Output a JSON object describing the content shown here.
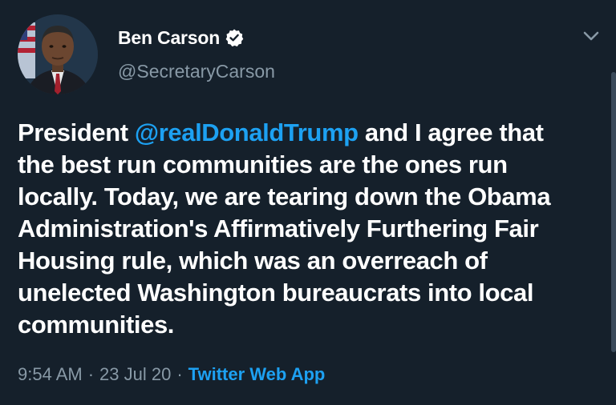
{
  "tweet": {
    "display_name": "Ben Carson",
    "handle": "@SecretaryCarson",
    "verified_icon": "verified-badge-icon",
    "caret_icon": "chevron-down-icon",
    "avatar_icon": "profile-photo",
    "text": {
      "line1_pre": "President ",
      "line1_mention": "@realDonaldTrump",
      "line1_post": " and I agree that",
      "line2": "the best run communities are the ones run",
      "line3": "locally. Today, we are tearing down the Obama",
      "line4": "Administration's Affirmatively Furthering Fair",
      "line5": "Housing rule, which was an overreach of",
      "line6": "unelected Washington bureaucrats into local",
      "line7": "communities."
    },
    "time": "9:54 AM",
    "date": "23 Jul 20",
    "separator": "·",
    "source": "Twitter Web App"
  },
  "colors": {
    "background": "#15202b",
    "text": "#ffffff",
    "secondary": "#8899a6",
    "accent": "#1da1f2"
  }
}
